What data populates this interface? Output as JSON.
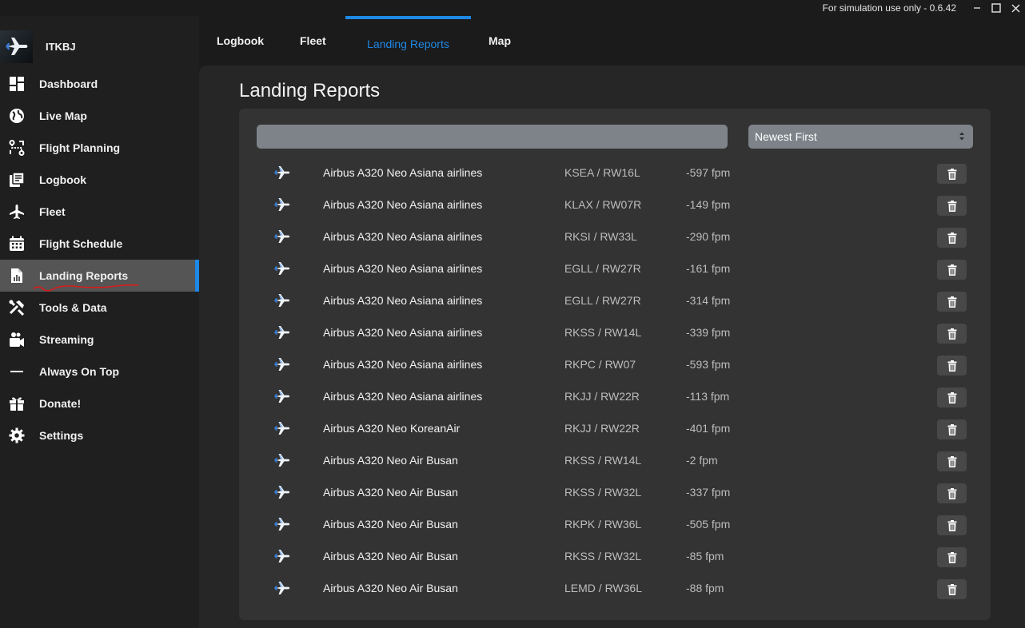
{
  "window": {
    "version_text": "For simulation use only - 0.6.42"
  },
  "profile": {
    "name": "ITKBJ"
  },
  "sidebar": {
    "items": [
      {
        "label": "Dashboard",
        "icon": "dashboard-icon"
      },
      {
        "label": "Live Map",
        "icon": "globe-icon"
      },
      {
        "label": "Flight Planning",
        "icon": "route-icon"
      },
      {
        "label": "Logbook",
        "icon": "logbook-icon"
      },
      {
        "label": "Fleet",
        "icon": "airplane-icon"
      },
      {
        "label": "Flight Schedule",
        "icon": "calendar-icon"
      },
      {
        "label": "Landing Reports",
        "icon": "report-icon",
        "active": true
      },
      {
        "label": "Tools & Data",
        "icon": "tools-icon"
      },
      {
        "label": "Streaming",
        "icon": "camera-icon"
      },
      {
        "label": "Always On Top",
        "icon": "minus-icon"
      },
      {
        "label": "Donate!",
        "icon": "gift-icon"
      },
      {
        "label": "Settings",
        "icon": "gear-icon"
      }
    ]
  },
  "tabs": [
    {
      "label": "Logbook"
    },
    {
      "label": "Fleet"
    },
    {
      "label": "Landing Reports",
      "active": true
    },
    {
      "label": "Map"
    }
  ],
  "main": {
    "title": "Landing Reports",
    "search": {
      "value": "",
      "placeholder": ""
    },
    "sort": {
      "selected": "Newest First"
    }
  },
  "reports": [
    {
      "aircraft": "Airbus A320 Neo Asiana airlines",
      "airport": "KSEA / RW16L",
      "rate": "-597 fpm"
    },
    {
      "aircraft": "Airbus A320 Neo Asiana airlines",
      "airport": "KLAX / RW07R",
      "rate": "-149 fpm"
    },
    {
      "aircraft": "Airbus A320 Neo Asiana airlines",
      "airport": "RKSI / RW33L",
      "rate": "-290 fpm"
    },
    {
      "aircraft": "Airbus A320 Neo Asiana airlines",
      "airport": "EGLL / RW27R",
      "rate": "-161 fpm"
    },
    {
      "aircraft": "Airbus A320 Neo Asiana airlines",
      "airport": "EGLL / RW27R",
      "rate": "-314 fpm"
    },
    {
      "aircraft": "Airbus A320 Neo Asiana airlines",
      "airport": "RKSS / RW14L",
      "rate": "-339 fpm"
    },
    {
      "aircraft": "Airbus A320 Neo Asiana airlines",
      "airport": "RKPC / RW07",
      "rate": "-593 fpm"
    },
    {
      "aircraft": "Airbus A320 Neo Asiana airlines",
      "airport": "RKJJ / RW22R",
      "rate": "-113 fpm"
    },
    {
      "aircraft": "Airbus A320 Neo KoreanAir",
      "airport": "RKJJ / RW22R",
      "rate": "-401 fpm"
    },
    {
      "aircraft": "Airbus A320 Neo Air Busan",
      "airport": "RKSS / RW14L",
      "rate": "-2 fpm"
    },
    {
      "aircraft": "Airbus A320 Neo Air Busan",
      "airport": "RKSS / RW32L",
      "rate": "-337 fpm"
    },
    {
      "aircraft": "Airbus A320 Neo Air Busan",
      "airport": "RKPK / RW36L",
      "rate": "-505 fpm"
    },
    {
      "aircraft": "Airbus A320 Neo Air Busan",
      "airport": "RKSS / RW32L",
      "rate": "-85 fpm"
    },
    {
      "aircraft": "Airbus A320 Neo Air Busan",
      "airport": "LEMD / RW36L",
      "rate": "-88 fpm"
    }
  ],
  "colors": {
    "accent": "#1e88e5",
    "sidebar_active": "#555555",
    "input_bg": "#7d8389",
    "card_bg": "#333333",
    "annotation_red": "#d81b1b"
  }
}
